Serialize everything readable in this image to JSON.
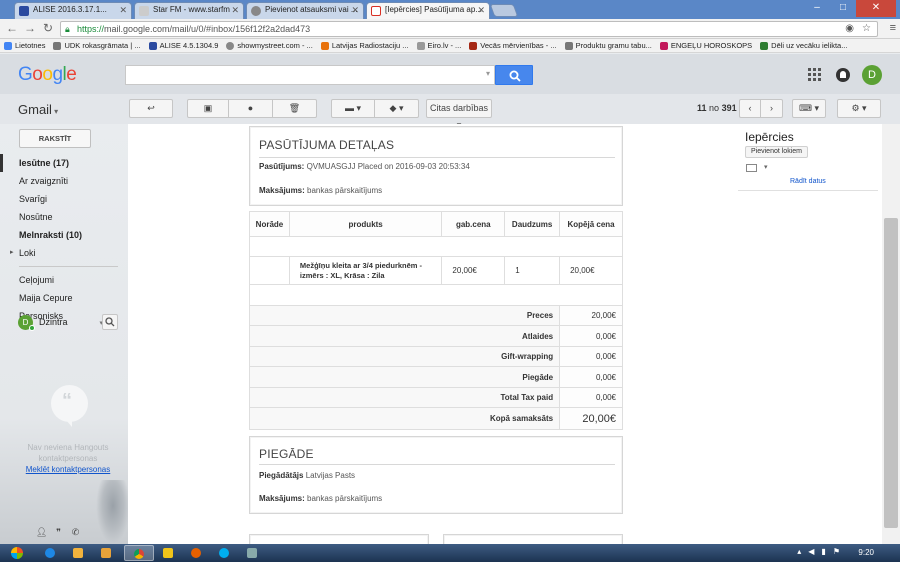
{
  "browser": {
    "tabs": [
      {
        "label": "ALISE 2016.3.17.1...",
        "color": "#2b4aa0"
      },
      {
        "label": "Star FM - www.starfm",
        "color": "#444444"
      },
      {
        "label": "Pievienot atsauksmi vai ...",
        "color": "#666666"
      },
      {
        "label": "[Iepērcies] Pasūtījuma ap...",
        "color": "#d93025"
      }
    ],
    "url_prefix": "https://",
    "url": "mail.google.com/mail/u/0/#inbox/156f12f2a2dad473",
    "bookmarks": [
      {
        "label": "Lietotnes",
        "color": "#4285f4"
      },
      {
        "label": "UDK rokasgrāmata | ...",
        "color": "#666666"
      },
      {
        "label": "ALISE 4.5.1304.9",
        "color": "#2b4aa0"
      },
      {
        "label": "showmystreet.com - ...",
        "color": "#888888"
      },
      {
        "label": "Latvijas Radiostaciju ...",
        "color": "#e8710a"
      },
      {
        "label": "Eiro.lv - ...",
        "color": "#777777"
      },
      {
        "label": "Vecās mērvienības - ...",
        "color": "#a52714"
      },
      {
        "label": "Produktu gramu tabu...",
        "color": "#666666"
      },
      {
        "label": "ENGEĻU HOROSKOPS",
        "color": "#c2185b"
      },
      {
        "label": "Dēli uz vecāku ielikta...",
        "color": "#2e7d32"
      }
    ]
  },
  "gmail": {
    "logo_letters": [
      {
        "ch": "G",
        "color": "#4285f4"
      },
      {
        "ch": "o",
        "color": "#ea4335"
      },
      {
        "ch": "o",
        "color": "#fbbc05"
      },
      {
        "ch": "g",
        "color": "#4285f4"
      },
      {
        "ch": "l",
        "color": "#34a853"
      },
      {
        "ch": "e",
        "color": "#ea4335"
      }
    ],
    "avatar_letter": "D",
    "gmail_label": "Gmail",
    "more_actions": "Citas darbības",
    "pager_range": "11",
    "pager_of": "no",
    "pager_total": "391",
    "compose_label": "RAKSTĪT",
    "nav": [
      {
        "label": "Iesūtne (17)",
        "style": "active"
      },
      {
        "label": "Ar zvaigznīti",
        "style": ""
      },
      {
        "label": "Svarīgi",
        "style": ""
      },
      {
        "label": "Nosūtne",
        "style": ""
      },
      {
        "label": "Melnraksti (10)",
        "style": "bold"
      },
      {
        "label": "Loki",
        "style": "arrow"
      }
    ],
    "nav_labels": [
      "Ceļojumi",
      "Maija Cepure",
      "Personisks"
    ],
    "contact_name": "Dzintra",
    "hangouts_text": "Nav neviena Hangouts kontaktpersonas",
    "hangouts_link": "Meklēt kontaktpersonas"
  },
  "email": {
    "details_title": "PASŪTĪJUMA DETAĻAS",
    "order_label": "Pasūtījums:",
    "order_value": "QVMUASGJJ Placed on 2016-09-03 20:53:34",
    "payment_label": "Maksājums:",
    "payment_value": "bankas pārskaitījums",
    "table_headers": [
      "Norāde",
      "produkts",
      "gab.cena",
      "Daudzums",
      "Kopējā cena"
    ],
    "item": {
      "product": "Mežģīņu kleita ar 3/4 piedurknēm - izmērs : XL, Krāsa : Zila",
      "unit_price": "20,00€",
      "qty": "1",
      "total": "20,00€"
    },
    "totals": [
      {
        "label": "Preces",
        "value": "20,00€"
      },
      {
        "label": "Atlaides",
        "value": "0,00€"
      },
      {
        "label": "Gift-wrapping",
        "value": "0,00€"
      },
      {
        "label": "Piegāde",
        "value": "0,00€"
      },
      {
        "label": "Total Tax paid",
        "value": "0,00€"
      },
      {
        "label": "Kopā samaksāts",
        "value": "20,00€"
      }
    ],
    "shipping_title": "PIEGĀDE",
    "carrier_label": "Piegādātājs",
    "carrier_value": "Latvijas Pasts",
    "shipping_payment_label": "Maksājums:",
    "shipping_payment_value": "bankas pārskaitījums"
  },
  "sidepanel": {
    "name": "Iepērcies",
    "add_button": "Pievienot lokiem",
    "show_details": "Rādīt datus"
  },
  "taskbar": {
    "time": "9:20"
  }
}
